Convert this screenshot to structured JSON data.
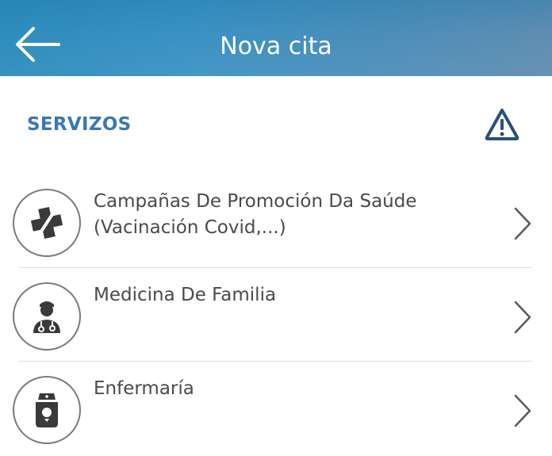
{
  "header": {
    "title": "Nova cita",
    "back_icon": "arrow-left-icon",
    "background_colors": [
      "#2e8cbc",
      "#5f8db1"
    ]
  },
  "section": {
    "title": "SERVIZOS",
    "title_color": "#3a78b6",
    "warning_icon": "warning-triangle-icon"
  },
  "services": [
    {
      "label": "Campañas De Promoción Da Saúde (Vacinación Covid,...)",
      "icon": "medical-cross-icon"
    },
    {
      "label": "Medicina De Familia",
      "icon": "doctor-icon"
    },
    {
      "label": "Enfermaría",
      "icon": "nurse-icon"
    }
  ],
  "chevron_icon": "chevron-right-icon"
}
